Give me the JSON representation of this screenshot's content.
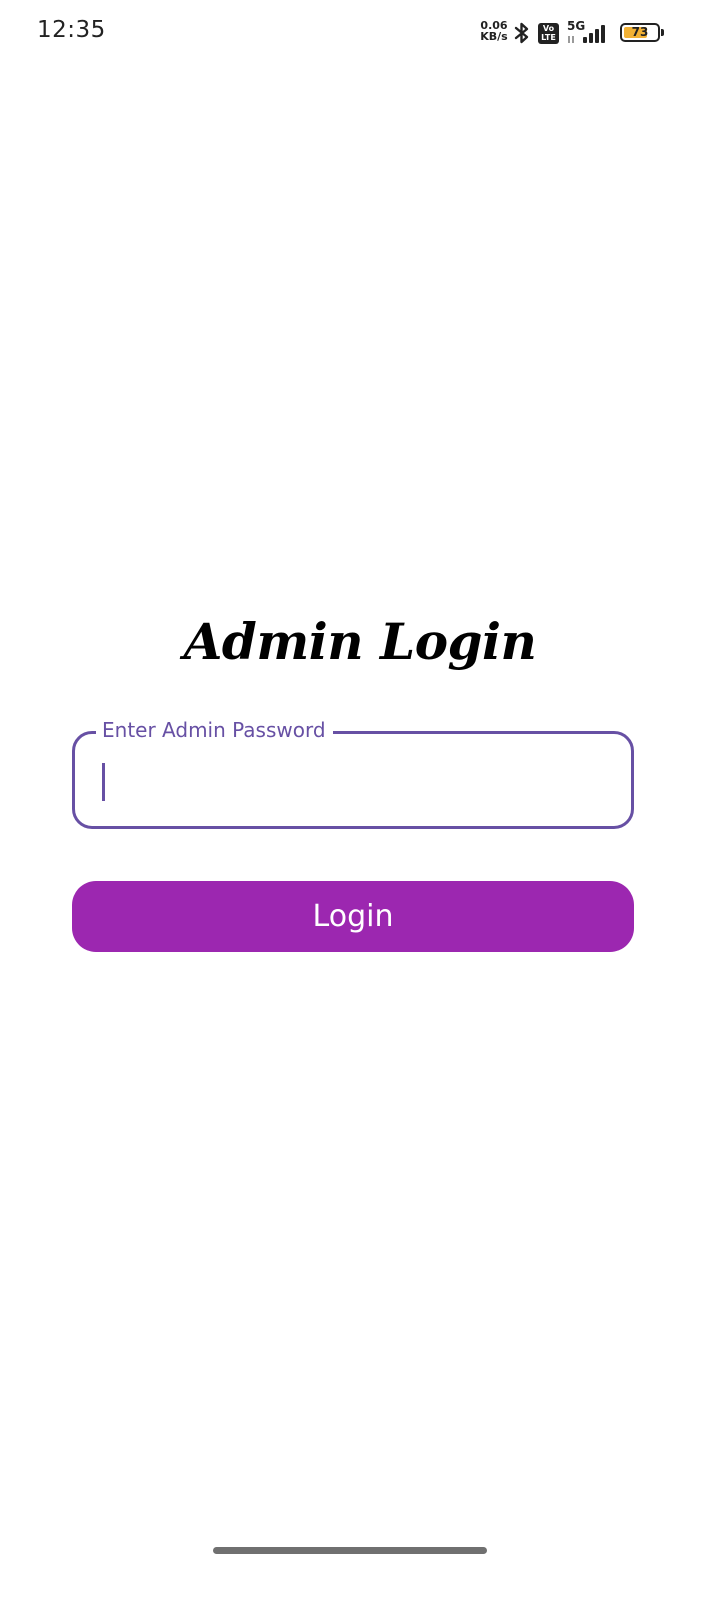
{
  "status_bar": {
    "time": "12:35",
    "net_speed_value": "0.06",
    "net_speed_unit": "KB/s",
    "volte_top": "Vo",
    "volte_bottom": "LTE",
    "network_type": "5G",
    "battery_level": "73",
    "battery_fraction": 0.73,
    "icons": [
      "bluetooth-icon",
      "volte-icon",
      "signal-icon",
      "battery-icon"
    ]
  },
  "login": {
    "title": "Admin Login",
    "password_label": "Enter Admin Password",
    "password_value": "",
    "button_label": "Login"
  },
  "colors": {
    "field_border": "#6750a4",
    "button_background": "#9c27b0",
    "button_text": "#ffffff",
    "battery_fill": "#f2b134"
  }
}
